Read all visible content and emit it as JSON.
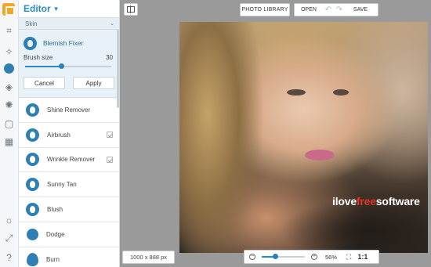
{
  "panel": {
    "title": "Editor",
    "category": "Skin",
    "active_tool": {
      "name": "Blemish Fixer",
      "brush_label": "Brush size",
      "brush_value": "30",
      "brush_fraction": 0.42,
      "cancel_label": "Cancel",
      "apply_label": "Apply"
    },
    "tools": [
      {
        "label": "Shine Remover",
        "icon": "face-icon",
        "checked": false
      },
      {
        "label": "Airbrush",
        "icon": "face-icon",
        "checked": true
      },
      {
        "label": "Wrinkle Remover",
        "icon": "face-icon",
        "checked": true
      },
      {
        "label": "Sunny Tan",
        "icon": "face-icon",
        "checked": false
      },
      {
        "label": "Blush",
        "icon": "face-icon",
        "checked": false
      },
      {
        "label": "Dodge",
        "icon": "magnify-icon",
        "checked": false
      },
      {
        "label": "Burn",
        "icon": "flame-icon",
        "checked": false
      }
    ]
  },
  "toolbar": {
    "photo_library": "PHOTO LIBRARY",
    "open": "OPEN",
    "save": "SAVE"
  },
  "status": {
    "dimensions": "1000 x 888 px",
    "zoom_percent": "56%",
    "zoom_fraction": 0.3,
    "actual_size": "1:1"
  },
  "watermark": {
    "part1": "ilove",
    "part2": "free",
    "part3": "software"
  },
  "colors": {
    "accent": "#2a8ac6",
    "watermark_red": "#e8332a"
  }
}
